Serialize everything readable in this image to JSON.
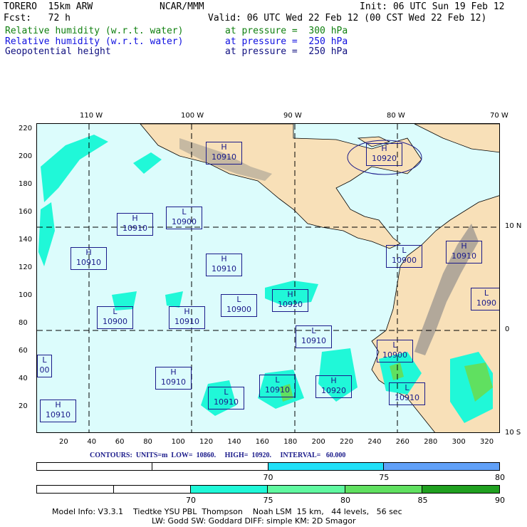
{
  "header": {
    "model": "TORERO  15km ARW",
    "org": "NCAR/MMM",
    "init": "Init: 06 UTC Sun 19 Feb 12",
    "fcst": "Fcst:   72 h",
    "valid": "Valid: 06 UTC Wed 22 Feb 12 (00 CST Wed 22 Feb 12)"
  },
  "fields": [
    {
      "name": "Relative humidity (w.r.t. water)",
      "level": "at pressure =  300 hPa",
      "color": "#108010"
    },
    {
      "name": "Relative humidity (w.r.t. water)",
      "level": "at pressure =  250 hPa",
      "color": "#1010e0"
    },
    {
      "name": "Geopotential height",
      "level": "at pressure =  250 hPa",
      "color": "#101080"
    }
  ],
  "axes": {
    "top": [
      "110 W",
      "100 W",
      "90 W",
      "80 W",
      "70 W"
    ],
    "right": [
      "10 N",
      "0",
      "10 S"
    ],
    "left": [
      "220",
      "200",
      "180",
      "160",
      "140",
      "120",
      "100",
      "80",
      "60",
      "40",
      "20"
    ],
    "bottom": [
      "20",
      "40",
      "60",
      "80",
      "100",
      "120",
      "140",
      "160",
      "180",
      "200",
      "220",
      "240",
      "260",
      "280",
      "300",
      "320"
    ]
  },
  "centers": [
    {
      "type": "H",
      "value": "10910"
    },
    {
      "type": "H",
      "value": "10920"
    },
    {
      "type": "H",
      "value": "10910"
    },
    {
      "type": "L",
      "value": "10900"
    },
    {
      "type": "H",
      "value": "10910"
    },
    {
      "type": "H",
      "value": "10910"
    },
    {
      "type": "L",
      "value": "10900"
    },
    {
      "type": "H",
      "value": "10910"
    },
    {
      "type": "L",
      "value": "10900"
    },
    {
      "type": "H",
      "value": "10920"
    },
    {
      "type": "L",
      "value": "10900"
    },
    {
      "type": "H",
      "value": "10910"
    },
    {
      "type": "L",
      "value": "1090"
    },
    {
      "type": "L",
      "value": "10910"
    },
    {
      "type": "L",
      "value": "10900"
    },
    {
      "type": "L",
      "value": "00"
    },
    {
      "type": "H",
      "value": "10910"
    },
    {
      "type": "L",
      "value": "10910"
    },
    {
      "type": "H",
      "value": "10920"
    },
    {
      "type": "L",
      "value": "10910"
    },
    {
      "type": "L",
      "value": "10910"
    },
    {
      "type": "H",
      "value": "10910"
    }
  ],
  "contours": "CONTOURS:  UNITS=m  LOW=  10860.     HIGH=  10920.     INTERVAL=   60.000",
  "colorbar_250": {
    "segments": [
      {
        "color": "#ffffff"
      },
      {
        "color": "#ffffff"
      },
      {
        "color": "#20e0f8"
      },
      {
        "color": "#60a0f8"
      }
    ],
    "labels": [
      "70",
      "75",
      "80",
      "%"
    ]
  },
  "colorbar_300": {
    "segments": [
      {
        "color": "#ffffff"
      },
      {
        "color": "#ffffff"
      },
      {
        "color": "#20f8d8"
      },
      {
        "color": "#60f8a0"
      },
      {
        "color": "#60e060"
      },
      {
        "color": "#20a020"
      }
    ],
    "labels": [
      "70",
      "75",
      "80",
      "85",
      "90",
      "%"
    ]
  },
  "footer": {
    "line1": "Model Info: V3.3.1    Tiedtke YSU PBL  Thompson    Noah LSM  15 km,   44 levels,   56 sec",
    "line2": "LW: Godd SW: Goddard DIFF: simple KM: 2D Smagor"
  }
}
